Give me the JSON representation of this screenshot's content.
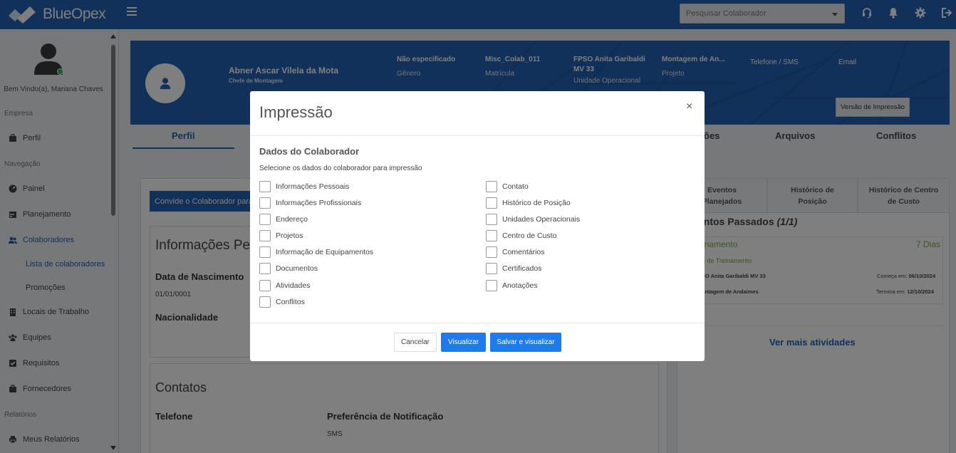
{
  "topbar": {
    "brand": "BlueOpex",
    "search_placeholder": "Pesquisar Colaborador"
  },
  "sidebar": {
    "welcome": "Bem Vindo(a), Mariana Chaves",
    "sections": {
      "empresa": "Empresa",
      "navegacao": "Navegação",
      "relatorios": "Relatórios"
    },
    "items": {
      "perfil": "Perfil",
      "painel": "Painel",
      "planejamento": "Planejamento",
      "colaboradores": "Colaboradores",
      "lista": "Lista de colaboradores",
      "promocoes": "Promoções",
      "locais": "Locais de Trabalho",
      "equipes": "Equipes",
      "requisitos": "Requisitos",
      "fornecedores": "Fornecedores",
      "meus_relatorios": "Meus Relatórios"
    }
  },
  "profile": {
    "name": "Abner Ascar Vilela da Mota",
    "role": "Chefe de Montagem",
    "gender_value": "Não especificado",
    "gender_label": "Gênero",
    "registration_value": "Misc_Colab_011",
    "registration_label": "Matrícula",
    "unit_value_1": "FPSO Anita Garibaldi",
    "unit_value_2": "MV 33",
    "unit_label": "Unidade Operacional",
    "project_value": "Montagem de An...",
    "project_label": "Projeto",
    "phone_label": "Telefone / SMS",
    "email_label": "Email",
    "print_button": "Versão de Impressão"
  },
  "tabs": {
    "perfil": "Perfil",
    "posicoes": "ões",
    "arquivos": "Arquivos",
    "conflitos": "Conflitos"
  },
  "main": {
    "invite_button": "Convide o Colaborador para",
    "info_title": "Informações Pes",
    "birth_label": "Data de Nascimento",
    "birth_value": "01/01/0001",
    "nationality_label": "Nacionalidade",
    "contacts_title": "Contatos",
    "phone_label": "Telefone",
    "notif_label": "Preferência de Notificação",
    "notif_value": "SMS"
  },
  "right": {
    "tab1_line1": "Eventos",
    "tab1_line2": "Planejados",
    "tab2_line1": "Histórico de",
    "tab2_line2": "Posição",
    "tab3_line1": "Histórico de Centro",
    "tab3_line2": "de Custo",
    "events_title": "entos Passados ",
    "events_count": "(1/1)",
    "event_type": "inamento",
    "event_days": "7 Dias",
    "event_sub": "a de Treinamento",
    "event_unit": "SO Anita Garibaldi MV 33",
    "event_start_label": "Começa em: ",
    "event_start": "06/10/2024",
    "event_project": "ontagem de Andaimes",
    "event_end_label": "Termina em: ",
    "event_end": "12/10/2024",
    "see_more": "Ver mais atividades"
  },
  "modal": {
    "title": "Impressão",
    "close": "×",
    "section_title": "Dados do Colaborador",
    "section_sub": "Selecione os dados do colaborador para impressão",
    "left_options": [
      "Informações Pessoais",
      "Informações Profissionais",
      "Endereço",
      "Projetos",
      "Informação de Equipamentos",
      "Documentos",
      "Atividades",
      "Conflitos"
    ],
    "right_options": [
      "Contato",
      "Histórico de Posição",
      "Unidades Operacionais",
      "Centro de Custo",
      "Comentários",
      "Certificados",
      "Anotações"
    ],
    "cancel": "Cancelar",
    "view": "Visualizar",
    "save_view": "Salvar e visualizar"
  }
}
